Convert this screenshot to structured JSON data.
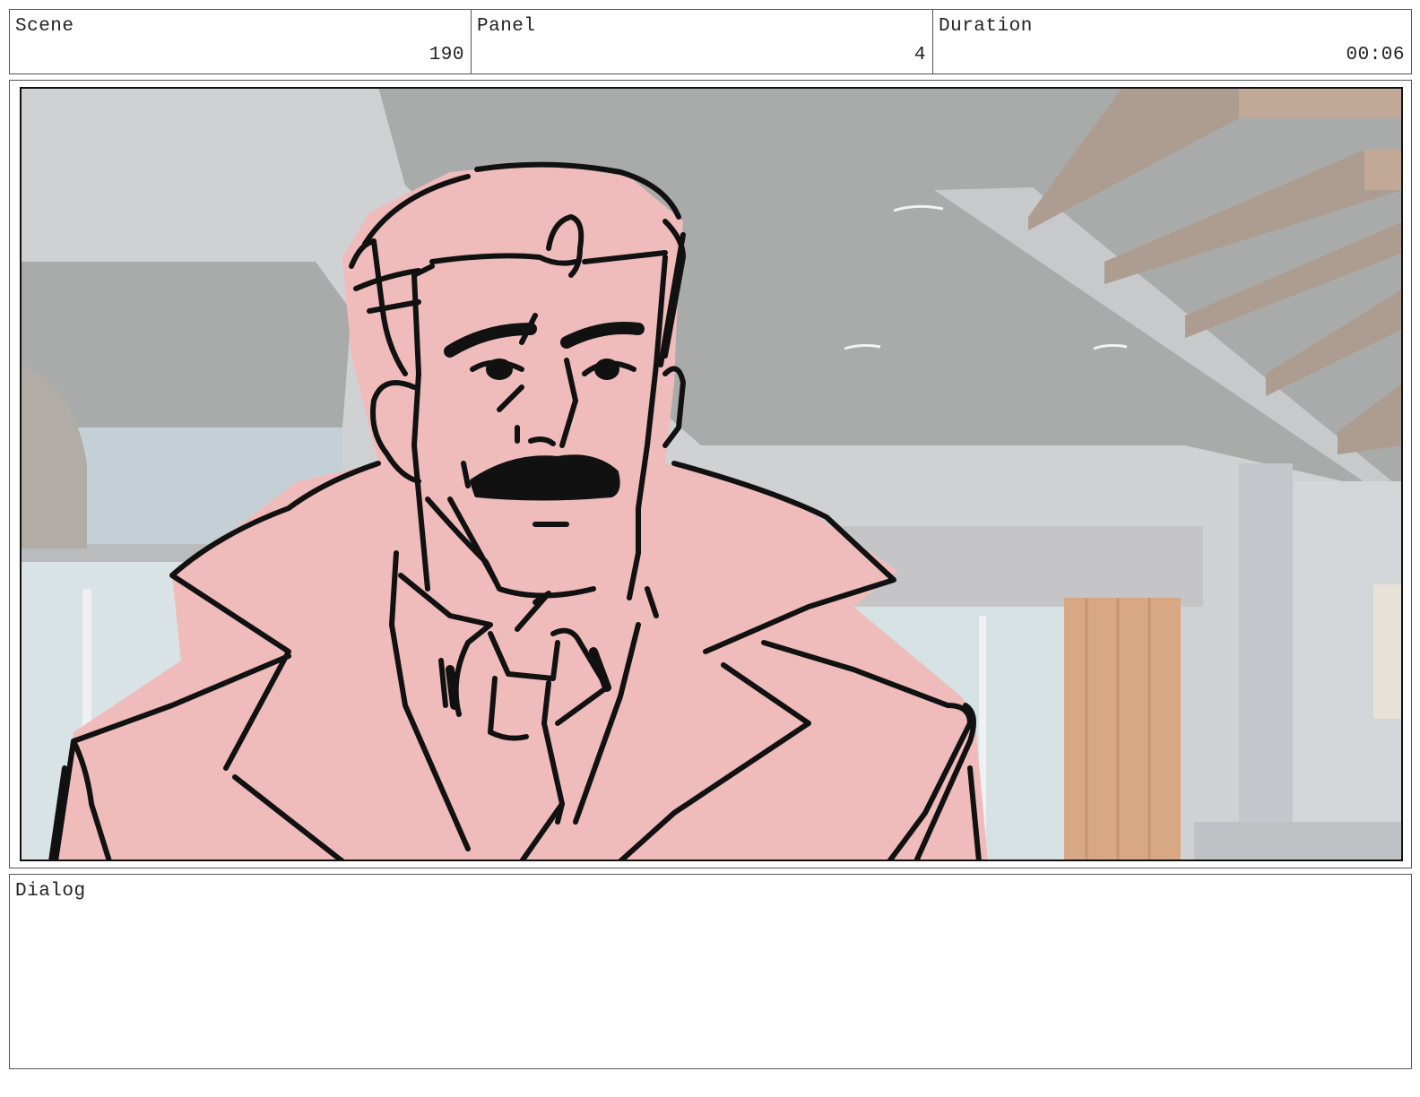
{
  "header": {
    "scene": {
      "label": "Scene",
      "value": "190"
    },
    "panel": {
      "label": "Panel",
      "value": "4"
    },
    "duration": {
      "label": "Duration",
      "value": "00:06"
    }
  },
  "dialog": {
    "label": "Dialog",
    "text": ""
  },
  "artwork": {
    "subject": "man-with-mustache-in-trench-coat",
    "colors": {
      "skin_fill": "#efbcbb",
      "line": "#111111",
      "background_ceiling": "#a9abaa",
      "background_wall": "#cfd1d3",
      "stairs": "#ad9d91",
      "curtain": "#d8a783"
    }
  }
}
